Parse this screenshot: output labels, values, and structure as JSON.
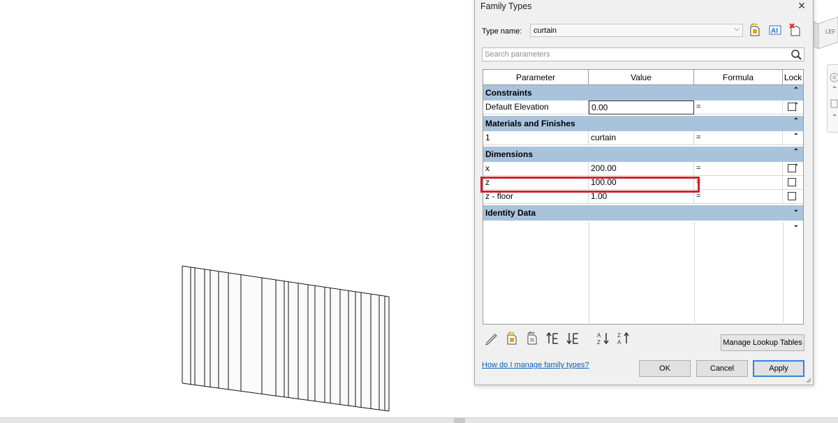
{
  "dialog": {
    "title": "Family Types",
    "type_name_label": "Type name:",
    "type_name_value": "curtain",
    "search_placeholder": "Search parameters",
    "columns": [
      "Parameter",
      "Value",
      "Formula",
      "Lock"
    ],
    "groups": {
      "constraints": {
        "label": "Constraints",
        "rows": [
          {
            "parameter": "Default Elevation",
            "value": "0.00",
            "formula": "=",
            "locked": false
          }
        ]
      },
      "materials": {
        "label": "Materials and Finishes",
        "rows": [
          {
            "parameter": "1",
            "value": "curtain",
            "formula": "="
          }
        ]
      },
      "dimensions": {
        "label": "Dimensions",
        "rows": [
          {
            "parameter": "x",
            "value": "200.00",
            "formula": "=",
            "locked": false
          },
          {
            "parameter": "z",
            "value": "100.00",
            "formula": "=",
            "locked": false
          },
          {
            "parameter": "z - floor",
            "value": "1.00",
            "formula": "=",
            "locked": false
          }
        ]
      },
      "identity": {
        "label": "Identity Data"
      }
    },
    "manage_lookup_label": "Manage Lookup Tables",
    "help_link": "How do I manage family types?",
    "ok_label": "OK",
    "cancel_label": "Cancel",
    "apply_label": "Apply"
  },
  "colors": {
    "group_header": "#a9c3dd",
    "highlight": "#d1232a",
    "link": "#0a5fb3",
    "default_button_border": "#3c7fd9"
  },
  "icons": [
    "pencil-icon",
    "new-parameter-icon",
    "modify-parameter-icon",
    "move-up-icon",
    "move-down-icon",
    "sort-ascending-icon",
    "sort-descending-icon",
    "new-type-icon",
    "rename-type-icon",
    "delete-type-icon",
    "search-icon",
    "close-icon",
    "chevron-down-icon",
    "collapse-icon",
    "expand-icon"
  ]
}
